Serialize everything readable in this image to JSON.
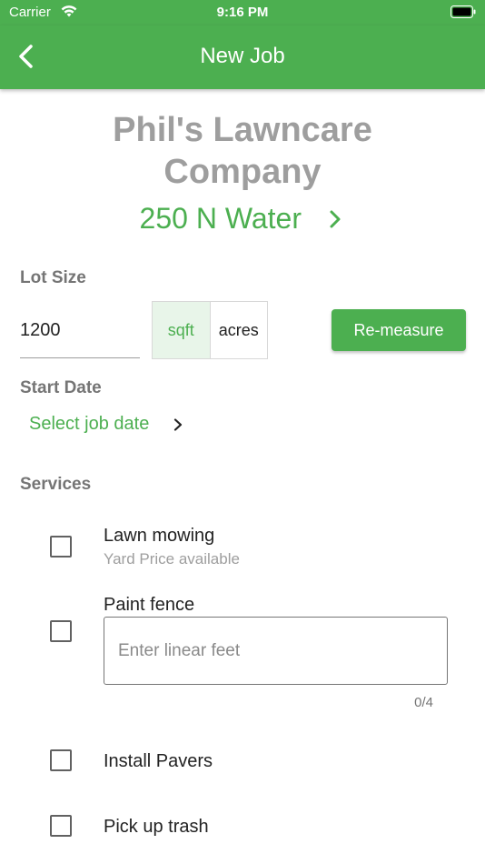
{
  "status_bar": {
    "carrier": "Carrier",
    "time": "9:16 PM",
    "wifi_icon": "wifi-icon",
    "battery_icon": "battery-icon"
  },
  "app_bar": {
    "title": "New Job",
    "back_icon": "back-arrow-icon",
    "color": "#4caf50"
  },
  "job": {
    "company_line1": "Phil's Lawncare",
    "company_line2": "Company",
    "address": "250 N Water",
    "address_icon": "chevron-right-icon"
  },
  "lot_size": {
    "label": "Lot Size",
    "value": "1200",
    "units": [
      {
        "label": "sqft",
        "selected": true
      },
      {
        "label": "acres",
        "selected": false
      }
    ],
    "remeasure_label": "Re-measure"
  },
  "start_date": {
    "label": "Start Date",
    "select_label": "Select job date",
    "icon": "chevron-right-icon"
  },
  "services": {
    "label": "Services",
    "items": [
      {
        "label": "Lawn mowing",
        "sublabel": "Yard Price available",
        "checked": false
      },
      {
        "label": "Paint fence",
        "input_placeholder": "Enter linear feet",
        "input_value": "",
        "counter": "0/4",
        "checked": false
      },
      {
        "label": "Install Pavers",
        "checked": false
      },
      {
        "label": "Pick up trash",
        "checked": false
      }
    ]
  },
  "colors": {
    "accent": "#4caf50",
    "accent_light": "#e8f5e9",
    "muted": "#9e9e9e"
  }
}
